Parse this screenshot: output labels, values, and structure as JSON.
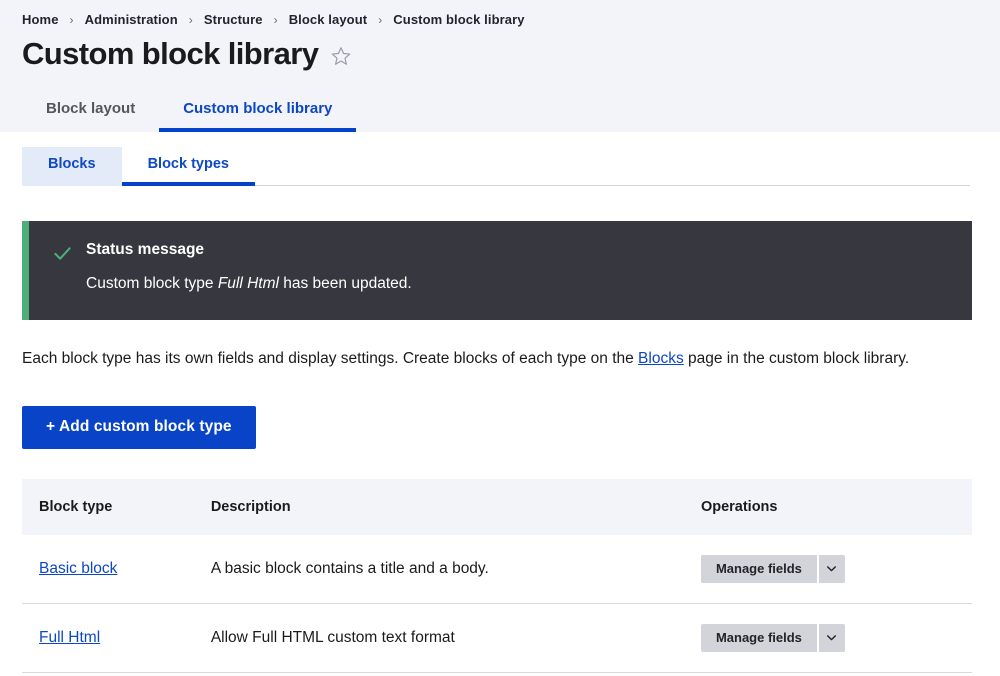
{
  "breadcrumb": {
    "separator": "›",
    "items": [
      {
        "label": "Home"
      },
      {
        "label": "Administration"
      },
      {
        "label": "Structure"
      },
      {
        "label": "Block layout"
      },
      {
        "label": "Custom block library"
      }
    ]
  },
  "header": {
    "title": "Custom block library",
    "star_icon": "star-outline-icon"
  },
  "primary_tabs": [
    {
      "label": "Block layout",
      "active": false
    },
    {
      "label": "Custom block library",
      "active": true
    }
  ],
  "secondary_tabs": [
    {
      "label": "Blocks",
      "active": false,
      "shaded": true
    },
    {
      "label": "Block types",
      "active": true,
      "shaded": false
    }
  ],
  "status_message": {
    "icon": "check-icon",
    "title": "Status message",
    "text_before": "Custom block type ",
    "emphasis": "Full Html",
    "text_after": " has been updated.",
    "accent_color": "#4dae7a",
    "background_color": "#36373f"
  },
  "description": {
    "text_before": "Each block type has its own fields and display settings. Create blocks of each type on the ",
    "link_label": "Blocks",
    "text_after": " page in the custom block library."
  },
  "add_button": {
    "label": "+ Add custom block type",
    "color": "#0943c8"
  },
  "table": {
    "columns": [
      "Block type",
      "Description",
      "Operations"
    ],
    "rows": [
      {
        "type": "Basic block",
        "description": "A basic block contains a title and a body.",
        "operation_label": "Manage fields",
        "toggle_icon": "chevron-down-icon"
      },
      {
        "type": "Full Html",
        "description": "Allow Full HTML custom text format",
        "operation_label": "Manage fields",
        "toggle_icon": "chevron-down-icon"
      }
    ]
  }
}
